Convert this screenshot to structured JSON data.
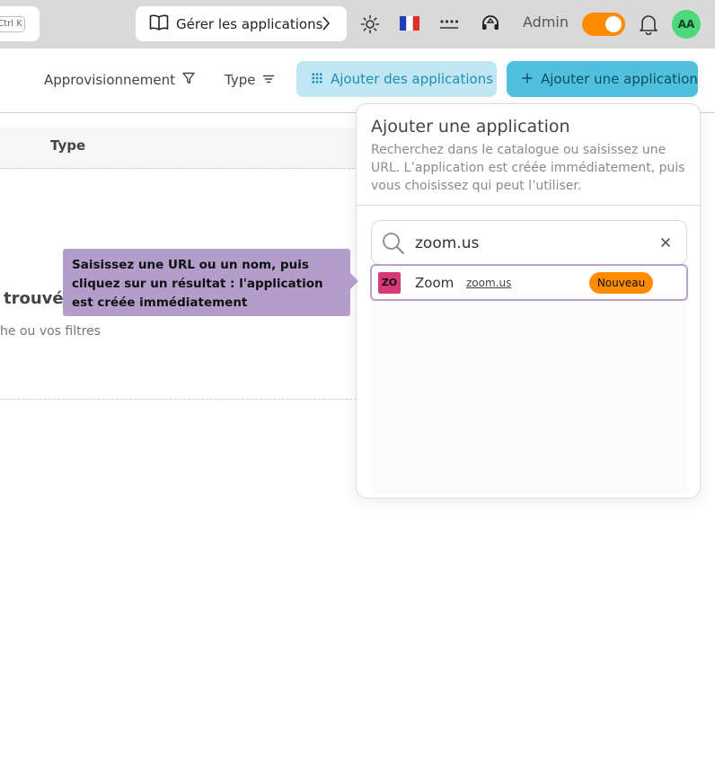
{
  "topbar": {
    "shortcut_hint": "Ctrl K",
    "manage_label": "Gérer les applications",
    "role_label": "Admin",
    "avatar_initials": "AA",
    "icons": [
      "book-icon",
      "chevron-right-icon",
      "sun-icon",
      "flag-fr-icon",
      "dots-icon",
      "headset-icon",
      "bell-icon"
    ],
    "toggle_on": true
  },
  "toolbar": {
    "filter_provisioning": "Approvisionnement",
    "filter_type": "Type",
    "add_apps_label": "Ajouter des applications",
    "add_app_label": "Ajouter une application"
  },
  "table": {
    "column_type": "Type",
    "empty_title": "trouvée",
    "empty_subtitle": "he ou vos filtres"
  },
  "panel": {
    "title": "Ajouter une application",
    "description": "Recherchez dans le catalogue ou saisissez une URL. L’application est créée immédiatement, puis vous choisissez qui peut l’utiliser.",
    "search_value": "zoom.us",
    "result": {
      "logo_text": "ZO",
      "name": "Zoom",
      "url": "zoom.us",
      "badge": "Nouveau"
    }
  },
  "tooltip": {
    "text": "Saisissez une URL ou un nom, puis cliquez sur un résultat : l'application est créée immédiatement"
  },
  "colors": {
    "accent_orange": "#ff8c00",
    "primary_cyan": "#4fc0dd",
    "light_cyan": "#bfe6f2",
    "tooltip_purple": "#b39dcb",
    "avatar_green": "#4cd97b"
  }
}
